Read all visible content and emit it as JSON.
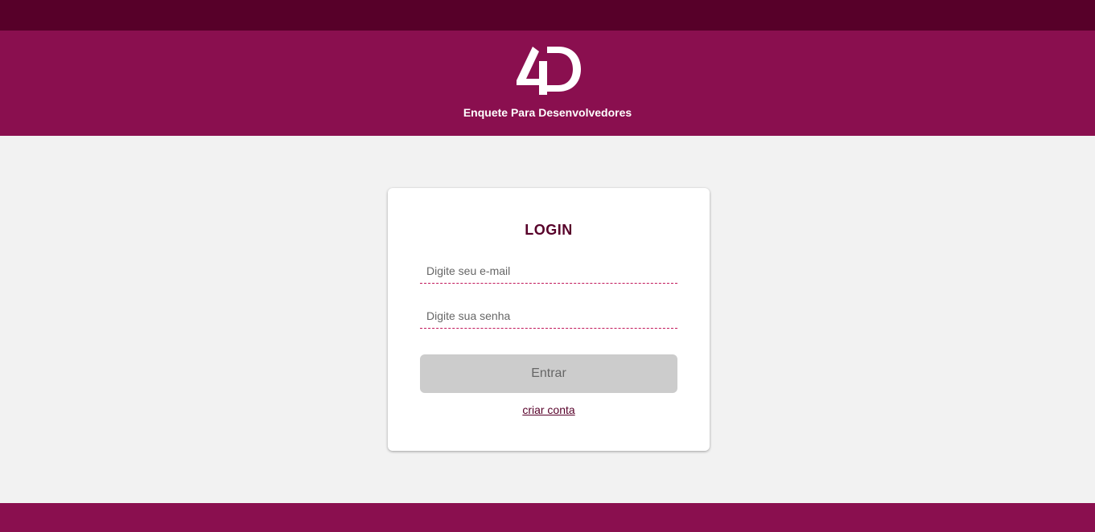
{
  "header": {
    "logo_text": "4D",
    "subtitle": "Enquete Para Desenvolvedores"
  },
  "login": {
    "title": "LOGIN",
    "email_placeholder": "Digite seu e-mail",
    "email_value": "",
    "password_placeholder": "Digite sua senha",
    "password_value": "",
    "submit_label": "Entrar",
    "create_account_label": "criar conta"
  },
  "colors": {
    "top_bar": "#570029",
    "header": "#8a0f4f",
    "footer": "#8a0f4f",
    "background": "#f2f2f2",
    "title": "#570029",
    "field_border": "#c2185b",
    "button_disabled": "#cccccc"
  }
}
